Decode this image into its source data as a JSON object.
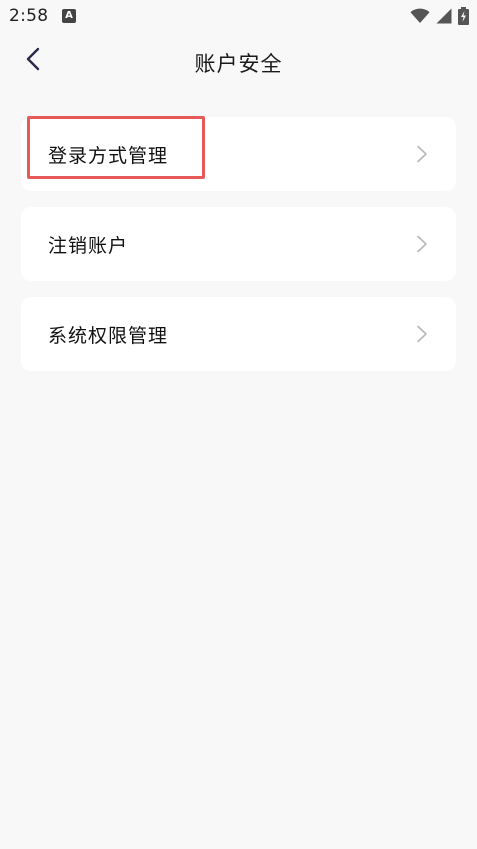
{
  "status_bar": {
    "time": "2:58",
    "app_icon_letter": "A",
    "icons": [
      "wifi-icon",
      "signal-icon",
      "battery-charging-icon"
    ]
  },
  "header": {
    "title": "账户安全",
    "back_icon": "chevron-left-icon"
  },
  "menu": {
    "items": [
      {
        "label": "登录方式管理",
        "icon": "chevron-right-icon",
        "highlighted": true
      },
      {
        "label": "注销账户",
        "icon": "chevron-right-icon",
        "highlighted": false
      },
      {
        "label": "系统权限管理",
        "icon": "chevron-right-icon",
        "highlighted": false
      }
    ]
  },
  "colors": {
    "background": "#f8f8f8",
    "card": "#ffffff",
    "highlight": "#e85a5a",
    "back_icon": "#2b2a4a",
    "chevron": "#b8b8b8"
  }
}
